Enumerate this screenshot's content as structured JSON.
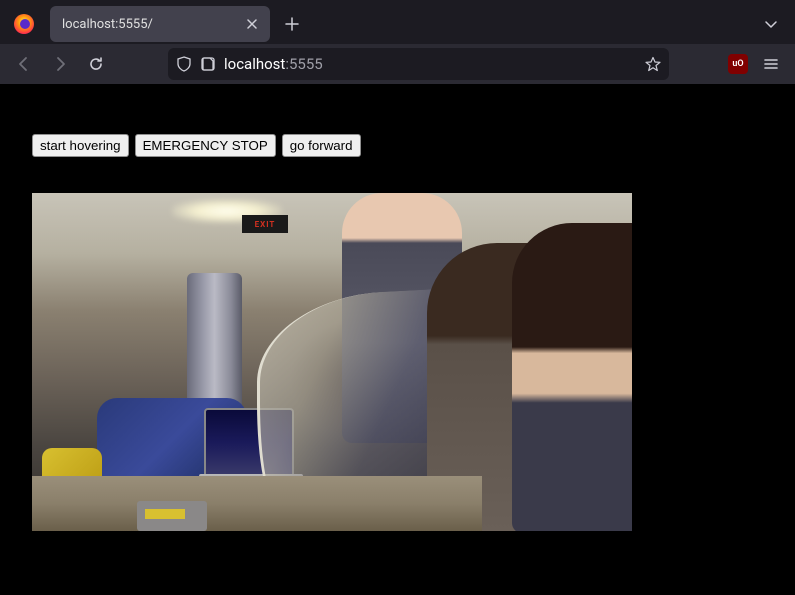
{
  "browser": {
    "tab_title": "localhost:5555/",
    "url_host": "localhost",
    "url_port": ":5555",
    "ublock_label": "uO"
  },
  "page": {
    "buttons": {
      "start_hovering": "start hovering",
      "emergency_stop": "EMERGENCY STOP",
      "go_forward": "go forward"
    }
  },
  "scene": {
    "exit_text": "EXIT"
  }
}
